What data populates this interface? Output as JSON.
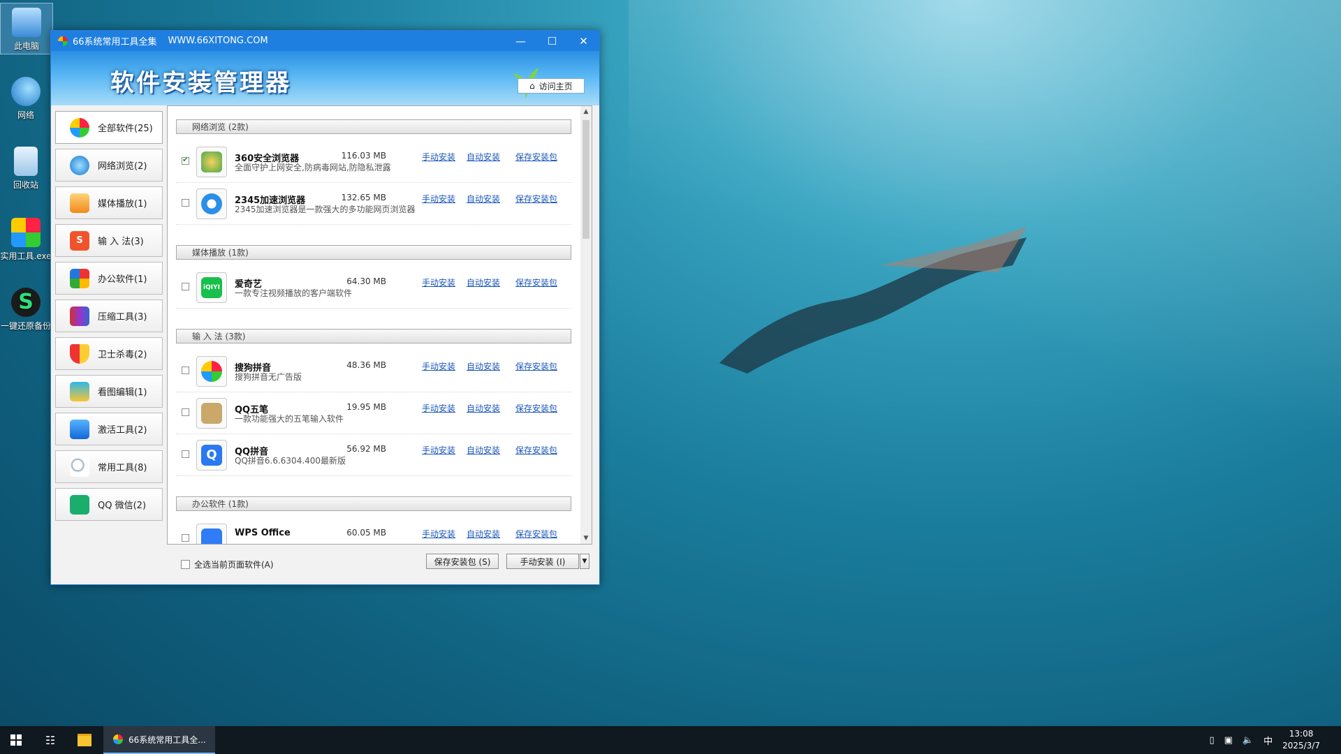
{
  "desktop": {
    "icons": [
      {
        "label": "此电脑"
      },
      {
        "label": "网络"
      },
      {
        "label": "回收站"
      },
      {
        "label": "实用工具.exe"
      },
      {
        "label": "一键还原备份"
      }
    ]
  },
  "window": {
    "title": "66系统常用工具全集",
    "url": "WWW.66XITONG.COM",
    "banner_title": "软件安装管理器",
    "home_button": "访问主页"
  },
  "sidebar": {
    "items": [
      {
        "label": "全部软件(25)",
        "icon": "windows-logo-icon"
      },
      {
        "label": "网络浏览(2)",
        "icon": "ie-browser-icon"
      },
      {
        "label": "媒体播放(1)",
        "icon": "media-play-icon"
      },
      {
        "label": "输 入 法(3)",
        "icon": "sogou-input-icon"
      },
      {
        "label": "办公软件(1)",
        "icon": "office-icon"
      },
      {
        "label": "压缩工具(3)",
        "icon": "archive-icon"
      },
      {
        "label": "卫士杀毒(2)",
        "icon": "shield-icon"
      },
      {
        "label": "看图编辑(1)",
        "icon": "image-viewer-icon"
      },
      {
        "label": "激活工具(2)",
        "icon": "activation-cube-icon"
      },
      {
        "label": "常用工具(8)",
        "icon": "magnifier-icon"
      },
      {
        "label": "QQ 微信(2)",
        "icon": "wechat-icon"
      }
    ]
  },
  "categories": {
    "browser": "网络浏览 (2款)",
    "media": "媒体播放 (1款)",
    "input": "输 入 法 (3款)",
    "office": "办公软件 (1款)"
  },
  "links": {
    "manual": "手动安装",
    "auto": "自动安装",
    "save": "保存安装包"
  },
  "software": [
    {
      "name": "360安全浏览器",
      "desc": "全面守护上网安全,防病毒网站,防隐私泄露",
      "size": "116.03 MB",
      "checked": true
    },
    {
      "name": "2345加速浏览器",
      "desc": "2345加速浏览器是一款强大的多功能网页浏览器",
      "size": "132.65 MB",
      "checked": false
    },
    {
      "name": "爱奇艺",
      "desc": "一款专注视频播放的客户端软件",
      "size": "64.30 MB",
      "checked": false
    },
    {
      "name": "搜狗拼音",
      "desc": "搜狗拼音无广告版",
      "size": "48.36 MB",
      "checked": false
    },
    {
      "name": "QQ五笔",
      "desc": "一款功能强大的五笔输入软件",
      "size": "19.95 MB",
      "checked": false
    },
    {
      "name": "QQ拼音",
      "desc": "QQ拼音6.6.6304.400最新版",
      "size": "56.92 MB",
      "checked": false
    },
    {
      "name": "WPS Office",
      "desc": "",
      "size": "60.05 MB",
      "checked": false
    }
  ],
  "footer": {
    "select_all": "全选当前页面软件(A)",
    "save_button": "保存安装包 (S)",
    "install_button": "手动安装 (I)"
  },
  "taskbar": {
    "app_label": "66系统常用工具全...",
    "ime": "中",
    "time": "13:08",
    "date": "2025/3/7"
  },
  "colors": {
    "titlebar": "#1f7fe0",
    "link": "#1a56b8",
    "taskbar": "#101820"
  }
}
